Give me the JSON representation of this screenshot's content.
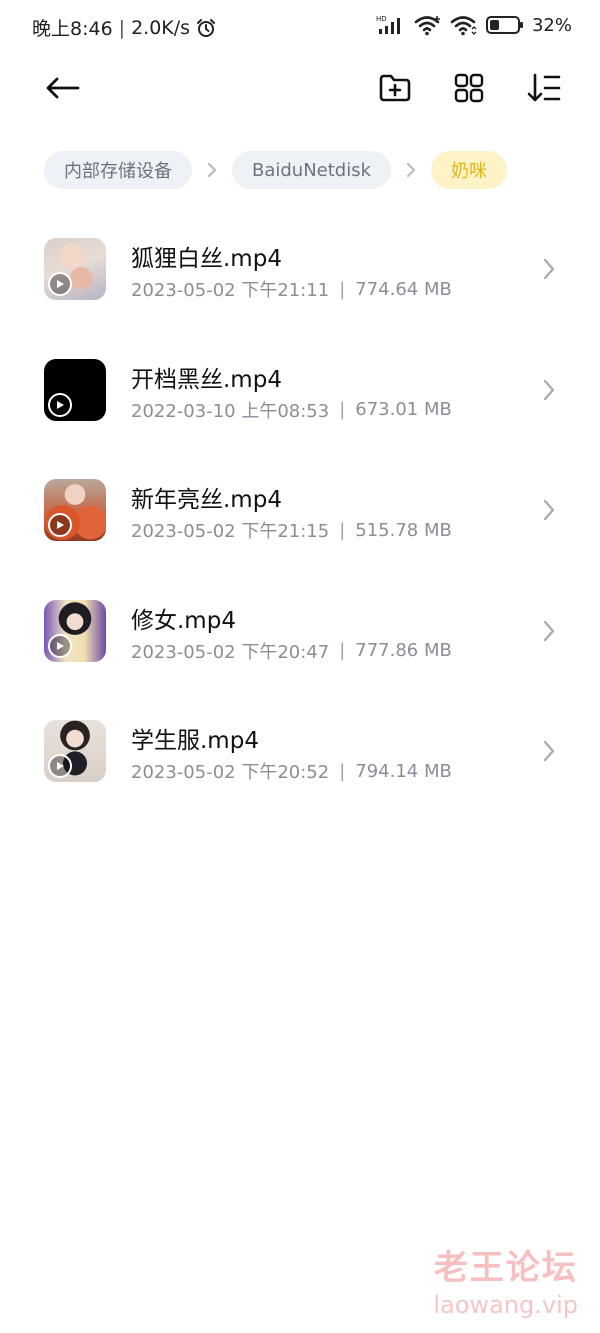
{
  "status_bar": {
    "time": "晚上8:46",
    "speed": "2.0K/s",
    "battery": "32%",
    "hd_label": "HD"
  },
  "toolbar": {
    "back_icon": "arrow-left-icon",
    "new_folder_icon": "folder-plus-icon",
    "grid_icon": "grid-view-icon",
    "sort_icon": "sort-icon"
  },
  "breadcrumb": {
    "items": [
      {
        "label": "内部存储设备"
      },
      {
        "label": "BaiduNetdisk"
      },
      {
        "label": "奶咪"
      }
    ],
    "active_color": "#e1b51b",
    "active_bg": "#fdf3c7"
  },
  "files": [
    {
      "name": "狐狸白丝.mp4",
      "date": "2023-05-02 下午21:11",
      "size": "774.64 MB"
    },
    {
      "name": "开档黑丝.mp4",
      "date": "2022-03-10 上午08:53",
      "size": "673.01 MB"
    },
    {
      "name": "新年亮丝.mp4",
      "date": "2023-05-02 下午21:15",
      "size": "515.78 MB"
    },
    {
      "name": "修女.mp4",
      "date": "2023-05-02 下午20:47",
      "size": "777.86 MB"
    },
    {
      "name": "学生服.mp4",
      "date": "2023-05-02 下午20:52",
      "size": "794.14 MB"
    }
  ],
  "watermark": {
    "title": "老王论坛",
    "url": "laowang.vip"
  }
}
